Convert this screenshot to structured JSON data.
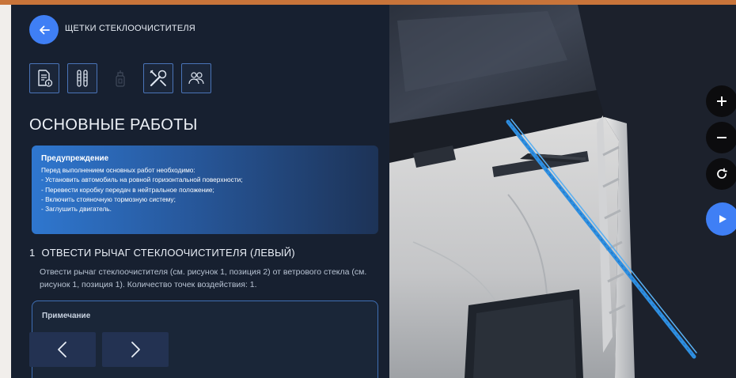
{
  "header": {
    "title": "ЩЕТКИ СТЕКЛООЧИСТИТЕЛЯ"
  },
  "toolbar": {
    "icons": [
      "document-info-icon",
      "wiper-brushes-icon",
      "spray-bottle-icon",
      "tools-icon",
      "people-icon"
    ]
  },
  "section": {
    "title": "ОСНОВНЫЕ РАБОТЫ"
  },
  "warning": {
    "title": "Предупреждение",
    "lines": [
      "Перед выполнением основных работ необходимо:",
      "- Установить автомобиль на ровной горизонтальной поверхности;",
      "- Перевести коробку передач в нейтральное положение;",
      "- Включить стояночную тормозную систему;",
      "- Заглушить двигатель."
    ]
  },
  "step": {
    "number": "1",
    "title": "ОТВЕСТИ РЫЧАГ СТЕКЛООЧИСТИТЕЛЯ (ЛЕВЫЙ)",
    "text": "Отвести рычаг стеклоочистителя (см. рисунок 1, позиция 2) от ветрового стекла (см. рисунок 1, позиция 1). Количество точек воздействия: 1."
  },
  "note": {
    "title": "Примечание"
  },
  "colors": {
    "accent": "#3f7ff5",
    "panel_bg": "#172030",
    "wiper": "#2f8fe0"
  }
}
